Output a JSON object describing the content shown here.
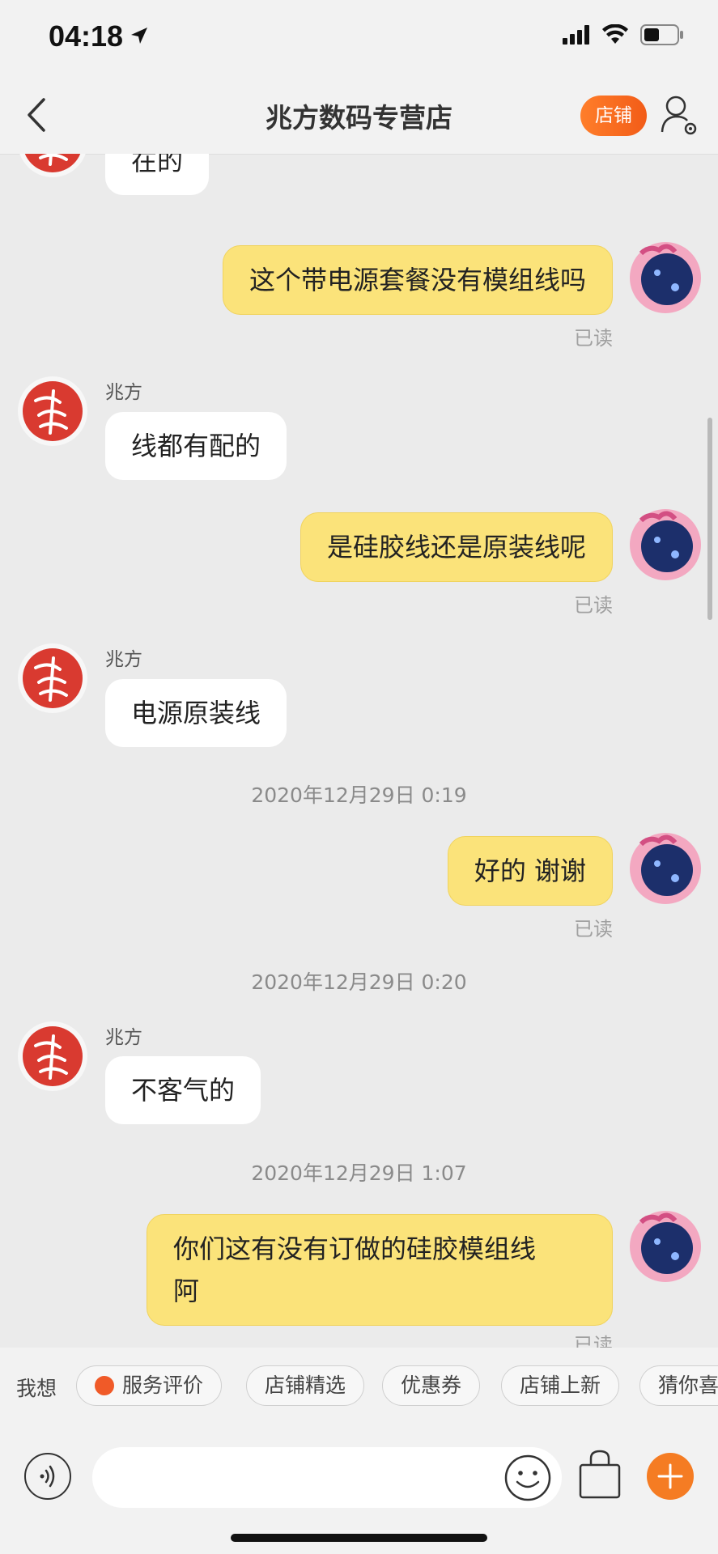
{
  "status": {
    "time": "04:18"
  },
  "header": {
    "title": "兆方数码专营店",
    "store_button": "店铺"
  },
  "messages": [
    {
      "dir": "in",
      "text": "在的"
    },
    {
      "dir": "out",
      "text": "这个带电源套餐没有模组线吗",
      "read": "已读"
    },
    {
      "dir": "in",
      "sender": "兆方",
      "text": "线都有配的"
    },
    {
      "dir": "out",
      "text": "是硅胶线还是原装线呢",
      "read": "已读"
    },
    {
      "dir": "in",
      "sender": "兆方",
      "text": "电源原装线"
    },
    {
      "timestamp": "2020年12月29日 0:19"
    },
    {
      "dir": "out",
      "text": "好的 谢谢",
      "read": "已读"
    },
    {
      "timestamp": "2020年12月29日 0:20"
    },
    {
      "dir": "in",
      "sender": "兆方",
      "text": "不客气的"
    },
    {
      "timestamp": "2020年12月29日 1:07"
    },
    {
      "dir": "out",
      "text": "你们这有没有订做的硅胶模组线\n阿",
      "read": "已读"
    }
  ],
  "quick_bar": {
    "label": "我想",
    "chips": [
      "服务评价",
      "店铺精选",
      "优惠券",
      "店铺上新",
      "猜你喜"
    ]
  },
  "input": {
    "placeholder": ""
  },
  "colors": {
    "accent": "#f57c23",
    "outgoing_bubble": "#fbe37a",
    "shop_avatar": "#d93a30"
  },
  "icons": [
    "back-icon",
    "profile-settings-icon",
    "voice-icon",
    "emoji-icon",
    "shopping-bag-icon",
    "plus-icon"
  ]
}
